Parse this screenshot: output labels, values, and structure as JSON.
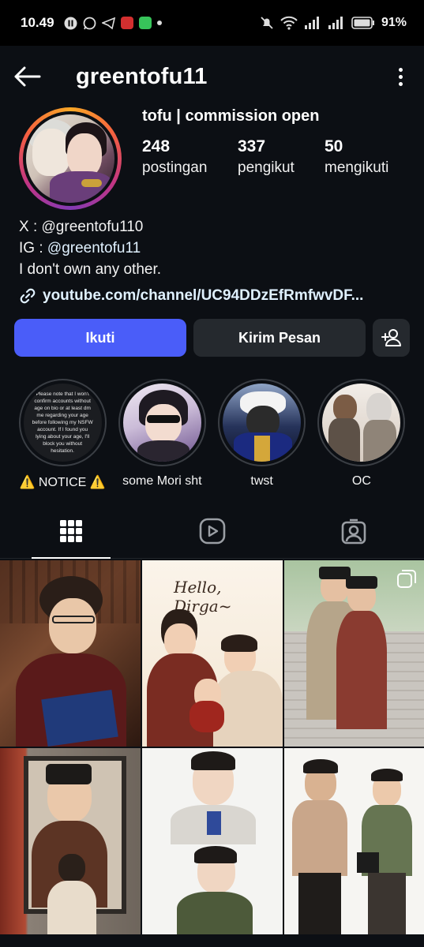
{
  "status_bar": {
    "time": "10.49",
    "battery": "91%",
    "icons": [
      "media-icon",
      "whatsapp-icon",
      "telegram-icon",
      "pay-icon",
      "chat-icon",
      "more-dot",
      "mute-icon",
      "wifi-icon",
      "signal-icon",
      "signal-icon",
      "battery-icon"
    ]
  },
  "header": {
    "username": "greentofu11",
    "back_icon": "arrow-left-icon",
    "menu_icon": "more-vertical-icon"
  },
  "profile": {
    "display_name": "tofu | commission open",
    "stats": [
      {
        "value": "248",
        "label": "postingan"
      },
      {
        "value": "337",
        "label": "pengikut"
      },
      {
        "value": "50",
        "label": "mengikuti"
      }
    ]
  },
  "bio": {
    "line1_prefix": "X : ",
    "line1_handle": "greentofu110",
    "line2_prefix": "IG : ",
    "line2_handle": "greentofu11",
    "line3": "I don't own any other.",
    "link": "youtube.com/channel/UC94DDzEfRmfwvDF..."
  },
  "actions": {
    "follow": "Ikuti",
    "message": "Kirim Pesan"
  },
  "highlights": [
    {
      "label": "⚠️ NOTICE ⚠️",
      "text": "Please note that I won't confirm accounts without age on bio or at least dm me regarding your age before following my NSFW account. If I found you lying about your age, I'll block you without hesitation."
    },
    {
      "label": "some Mori sht"
    },
    {
      "label": "twst"
    },
    {
      "label": "OC"
    }
  ],
  "tabs": [
    "grid-icon",
    "reels-icon",
    "tagged-icon"
  ],
  "posts": [
    {
      "caption": ""
    },
    {
      "caption": "Hello, Dirga~"
    },
    {
      "caption": ""
    },
    {
      "caption": ""
    },
    {
      "caption": ""
    },
    {
      "caption": ""
    }
  ],
  "colors": {
    "background": "#0c0f14",
    "follow_button": "#4a5df9",
    "secondary_button": "#25292e",
    "link": "#e0f1ff"
  }
}
